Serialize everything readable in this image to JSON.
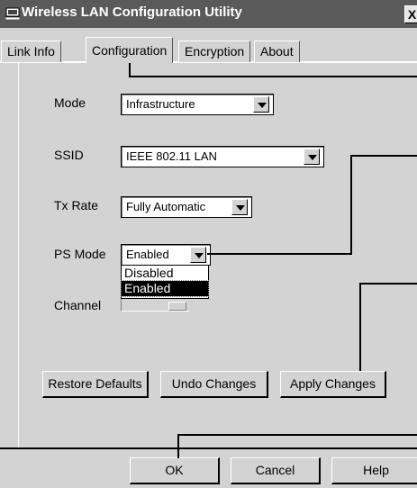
{
  "window": {
    "title": "Wireless LAN Configuration Utility",
    "close_label": "X"
  },
  "tabs": [
    {
      "label": "Link Info"
    },
    {
      "label": "Configuration"
    },
    {
      "label": "Encryption"
    },
    {
      "label": "About"
    }
  ],
  "form": {
    "mode": {
      "label": "Mode",
      "value": "Infrastructure"
    },
    "ssid": {
      "label": "SSID",
      "value": "IEEE 802.11 LAN"
    },
    "tx_rate": {
      "label": "Tx Rate",
      "value": "Fully Automatic"
    },
    "ps_mode": {
      "label": "PS Mode",
      "value": "Enabled",
      "options": [
        "Disabled",
        "Enabled"
      ],
      "highlighted": "Enabled"
    },
    "channel": {
      "label": "Channel"
    }
  },
  "buttons": {
    "restore_defaults": "Restore Defaults",
    "undo_changes": "Undo Changes",
    "apply_changes": "Apply Changes",
    "ok": "OK",
    "cancel": "Cancel",
    "help": "Help"
  }
}
